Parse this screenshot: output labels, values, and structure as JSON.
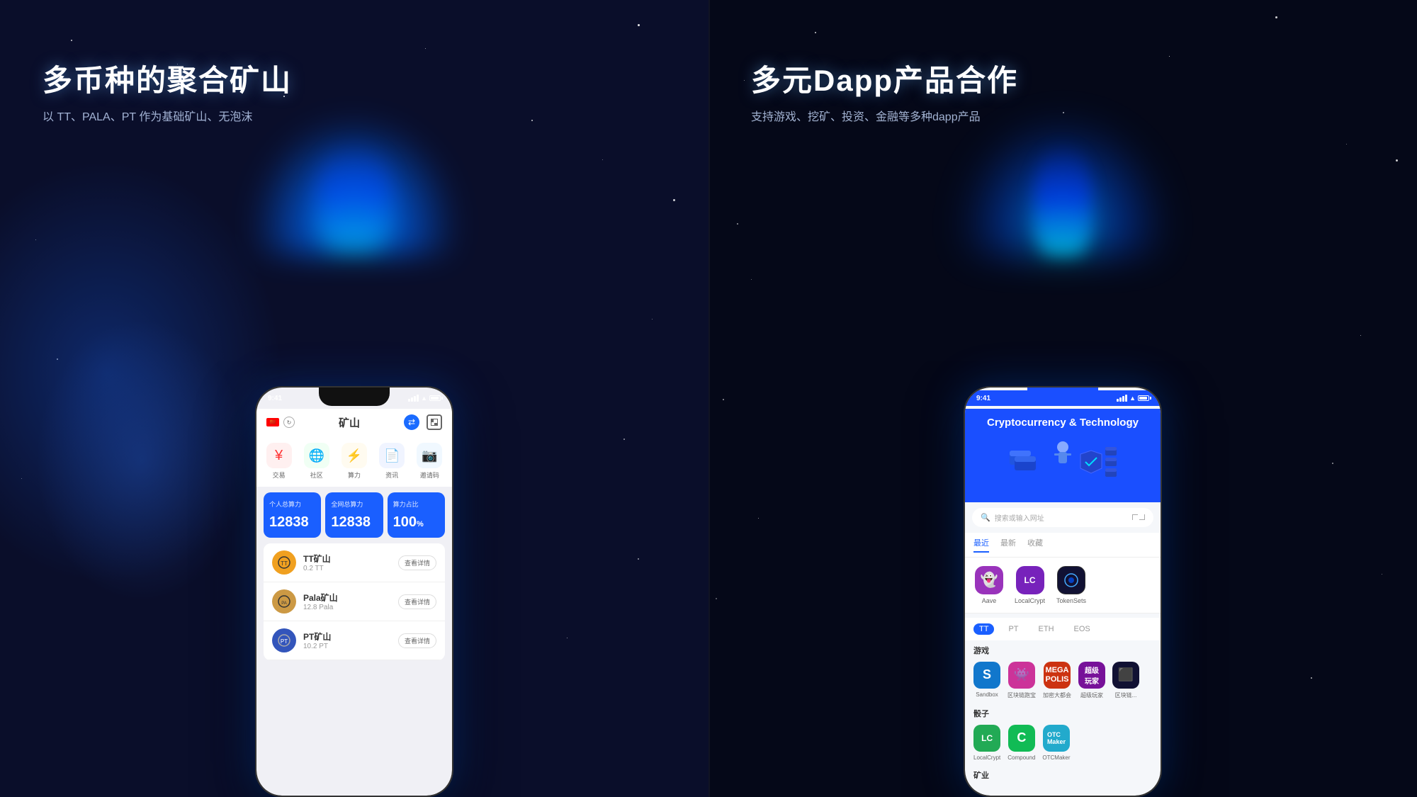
{
  "left_panel": {
    "title": "多币种的聚合矿山",
    "subtitle": "以 TT、PALA、PT 作为基础矿山、无泡沫",
    "phone": {
      "time": "9:41",
      "app_title": "矿山",
      "nav_items": [
        {
          "icon": "¥",
          "label": "交易",
          "color": "#ff4444"
        },
        {
          "icon": "🌐",
          "label": "社区",
          "color": "#22cc66"
        },
        {
          "icon": "⚡",
          "label": "算力",
          "color": "#ffaa00"
        },
        {
          "icon": "📄",
          "label": "资讯",
          "color": "#4488ff"
        },
        {
          "icon": "📷",
          "label": "邀请码",
          "color": "#44aaff"
        }
      ],
      "stats": [
        {
          "label": "个人总算力",
          "value": "12838",
          "unit": ""
        },
        {
          "label": "全网总算力",
          "value": "12838",
          "unit": ""
        },
        {
          "label": "算力占比",
          "value": "100",
          "unit": "%"
        }
      ],
      "mines": [
        {
          "name": "TT矿山",
          "amount": "0.2 TT",
          "color": "#f0a020",
          "icon": "🔨",
          "btn": "查看详情"
        },
        {
          "name": "Pala矿山",
          "amount": "12.8 Pala",
          "color": "#aa8855",
          "icon": "⚙️",
          "btn": "查看详情"
        },
        {
          "name": "PT矿山",
          "amount": "10.2 PT",
          "color": "#4466cc",
          "icon": "🔵",
          "btn": "查看详情"
        }
      ]
    }
  },
  "right_panel": {
    "title": "多元Dapp产品合作",
    "subtitle": "支持游戏、挖矿、投资、金融等多种dapp产品",
    "phone": {
      "time": "9:41",
      "app_title": "Cryptocurrency &\nTechnology",
      "search_placeholder": "搜索或输入网址",
      "tabs": [
        {
          "label": "最近",
          "active": true
        },
        {
          "label": "最新",
          "active": false
        },
        {
          "label": "收藏",
          "active": false
        }
      ],
      "recent_apps": [
        {
          "label": "Aave",
          "color": "#9944bb",
          "icon": "👻"
        },
        {
          "label": "LocalCrypt",
          "color": "#8833cc",
          "icon": "LC"
        },
        {
          "label": "TokenSets",
          "color": "#1a1a2e",
          "icon": "S"
        }
      ],
      "chain_tabs": [
        "TT",
        "PT",
        "ETH",
        "EOS"
      ],
      "active_chain": "TT",
      "sections": [
        {
          "title": "游戏",
          "apps": [
            {
              "label": "Sandbox",
              "color": "#1188dd",
              "icon": "S"
            },
            {
              "label": "区块链跑宝",
              "color": "#cc44aa",
              "icon": "👾"
            },
            {
              "label": "加密大都会",
              "color": "#dd4411",
              "icon": "M"
            },
            {
              "label": "超级玩家",
              "color": "#882299",
              "icon": "SP"
            },
            {
              "label": "区块链...",
              "color": "#222244",
              "icon": "⬛"
            }
          ]
        },
        {
          "title": "骰子",
          "apps": [
            {
              "label": "LocalCrypt",
              "color": "#22aa55",
              "icon": "LC"
            },
            {
              "label": "Compound",
              "color": "#22cc66",
              "icon": "C"
            },
            {
              "label": "OTCMaker",
              "color": "#22aacc",
              "icon": "OTC"
            }
          ]
        },
        {
          "title": "矿业",
          "apps": []
        }
      ]
    }
  }
}
